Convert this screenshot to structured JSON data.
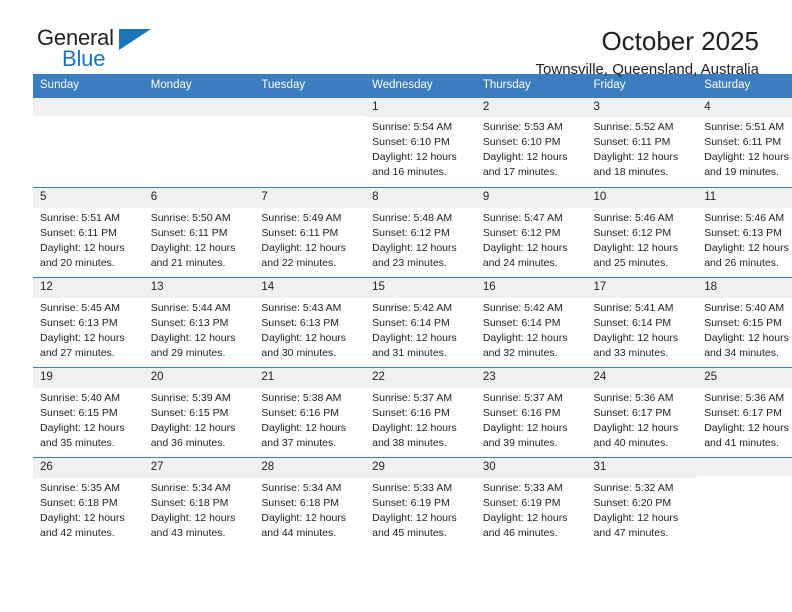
{
  "brand": {
    "name_top": "General",
    "name_bottom": "Blue"
  },
  "header": {
    "title": "October 2025",
    "subtitle": "Townsville, Queensland, Australia"
  },
  "colors": {
    "header_blue": "#3b7dbf",
    "brand_blue": "#1b75bb",
    "daynum_background": "#f0f0f0",
    "text": "#231f20"
  },
  "calendar": {
    "weekday_headers": [
      "Sunday",
      "Monday",
      "Tuesday",
      "Wednesday",
      "Thursday",
      "Friday",
      "Saturday"
    ],
    "weeks": [
      [
        {
          "day": "",
          "empty": true
        },
        {
          "day": "",
          "empty": true
        },
        {
          "day": "",
          "empty": true
        },
        {
          "day": "1",
          "sunrise": "Sunrise: 5:54 AM",
          "sunset": "Sunset: 6:10 PM",
          "daylight": "Daylight: 12 hours and 16 minutes."
        },
        {
          "day": "2",
          "sunrise": "Sunrise: 5:53 AM",
          "sunset": "Sunset: 6:10 PM",
          "daylight": "Daylight: 12 hours and 17 minutes."
        },
        {
          "day": "3",
          "sunrise": "Sunrise: 5:52 AM",
          "sunset": "Sunset: 6:11 PM",
          "daylight": "Daylight: 12 hours and 18 minutes."
        },
        {
          "day": "4",
          "sunrise": "Sunrise: 5:51 AM",
          "sunset": "Sunset: 6:11 PM",
          "daylight": "Daylight: 12 hours and 19 minutes."
        }
      ],
      [
        {
          "day": "5",
          "sunrise": "Sunrise: 5:51 AM",
          "sunset": "Sunset: 6:11 PM",
          "daylight": "Daylight: 12 hours and 20 minutes."
        },
        {
          "day": "6",
          "sunrise": "Sunrise: 5:50 AM",
          "sunset": "Sunset: 6:11 PM",
          "daylight": "Daylight: 12 hours and 21 minutes."
        },
        {
          "day": "7",
          "sunrise": "Sunrise: 5:49 AM",
          "sunset": "Sunset: 6:11 PM",
          "daylight": "Daylight: 12 hours and 22 minutes."
        },
        {
          "day": "8",
          "sunrise": "Sunrise: 5:48 AM",
          "sunset": "Sunset: 6:12 PM",
          "daylight": "Daylight: 12 hours and 23 minutes."
        },
        {
          "day": "9",
          "sunrise": "Sunrise: 5:47 AM",
          "sunset": "Sunset: 6:12 PM",
          "daylight": "Daylight: 12 hours and 24 minutes."
        },
        {
          "day": "10",
          "sunrise": "Sunrise: 5:46 AM",
          "sunset": "Sunset: 6:12 PM",
          "daylight": "Daylight: 12 hours and 25 minutes."
        },
        {
          "day": "11",
          "sunrise": "Sunrise: 5:46 AM",
          "sunset": "Sunset: 6:13 PM",
          "daylight": "Daylight: 12 hours and 26 minutes."
        }
      ],
      [
        {
          "day": "12",
          "sunrise": "Sunrise: 5:45 AM",
          "sunset": "Sunset: 6:13 PM",
          "daylight": "Daylight: 12 hours and 27 minutes."
        },
        {
          "day": "13",
          "sunrise": "Sunrise: 5:44 AM",
          "sunset": "Sunset: 6:13 PM",
          "daylight": "Daylight: 12 hours and 29 minutes."
        },
        {
          "day": "14",
          "sunrise": "Sunrise: 5:43 AM",
          "sunset": "Sunset: 6:13 PM",
          "daylight": "Daylight: 12 hours and 30 minutes."
        },
        {
          "day": "15",
          "sunrise": "Sunrise: 5:42 AM",
          "sunset": "Sunset: 6:14 PM",
          "daylight": "Daylight: 12 hours and 31 minutes."
        },
        {
          "day": "16",
          "sunrise": "Sunrise: 5:42 AM",
          "sunset": "Sunset: 6:14 PM",
          "daylight": "Daylight: 12 hours and 32 minutes."
        },
        {
          "day": "17",
          "sunrise": "Sunrise: 5:41 AM",
          "sunset": "Sunset: 6:14 PM",
          "daylight": "Daylight: 12 hours and 33 minutes."
        },
        {
          "day": "18",
          "sunrise": "Sunrise: 5:40 AM",
          "sunset": "Sunset: 6:15 PM",
          "daylight": "Daylight: 12 hours and 34 minutes."
        }
      ],
      [
        {
          "day": "19",
          "sunrise": "Sunrise: 5:40 AM",
          "sunset": "Sunset: 6:15 PM",
          "daylight": "Daylight: 12 hours and 35 minutes."
        },
        {
          "day": "20",
          "sunrise": "Sunrise: 5:39 AM",
          "sunset": "Sunset: 6:15 PM",
          "daylight": "Daylight: 12 hours and 36 minutes."
        },
        {
          "day": "21",
          "sunrise": "Sunrise: 5:38 AM",
          "sunset": "Sunset: 6:16 PM",
          "daylight": "Daylight: 12 hours and 37 minutes."
        },
        {
          "day": "22",
          "sunrise": "Sunrise: 5:37 AM",
          "sunset": "Sunset: 6:16 PM",
          "daylight": "Daylight: 12 hours and 38 minutes."
        },
        {
          "day": "23",
          "sunrise": "Sunrise: 5:37 AM",
          "sunset": "Sunset: 6:16 PM",
          "daylight": "Daylight: 12 hours and 39 minutes."
        },
        {
          "day": "24",
          "sunrise": "Sunrise: 5:36 AM",
          "sunset": "Sunset: 6:17 PM",
          "daylight": "Daylight: 12 hours and 40 minutes."
        },
        {
          "day": "25",
          "sunrise": "Sunrise: 5:36 AM",
          "sunset": "Sunset: 6:17 PM",
          "daylight": "Daylight: 12 hours and 41 minutes."
        }
      ],
      [
        {
          "day": "26",
          "sunrise": "Sunrise: 5:35 AM",
          "sunset": "Sunset: 6:18 PM",
          "daylight": "Daylight: 12 hours and 42 minutes."
        },
        {
          "day": "27",
          "sunrise": "Sunrise: 5:34 AM",
          "sunset": "Sunset: 6:18 PM",
          "daylight": "Daylight: 12 hours and 43 minutes."
        },
        {
          "day": "28",
          "sunrise": "Sunrise: 5:34 AM",
          "sunset": "Sunset: 6:18 PM",
          "daylight": "Daylight: 12 hours and 44 minutes."
        },
        {
          "day": "29",
          "sunrise": "Sunrise: 5:33 AM",
          "sunset": "Sunset: 6:19 PM",
          "daylight": "Daylight: 12 hours and 45 minutes."
        },
        {
          "day": "30",
          "sunrise": "Sunrise: 5:33 AM",
          "sunset": "Sunset: 6:19 PM",
          "daylight": "Daylight: 12 hours and 46 minutes."
        },
        {
          "day": "31",
          "sunrise": "Sunrise: 5:32 AM",
          "sunset": "Sunset: 6:20 PM",
          "daylight": "Daylight: 12 hours and 47 minutes."
        },
        {
          "day": "",
          "empty": true
        }
      ]
    ]
  }
}
